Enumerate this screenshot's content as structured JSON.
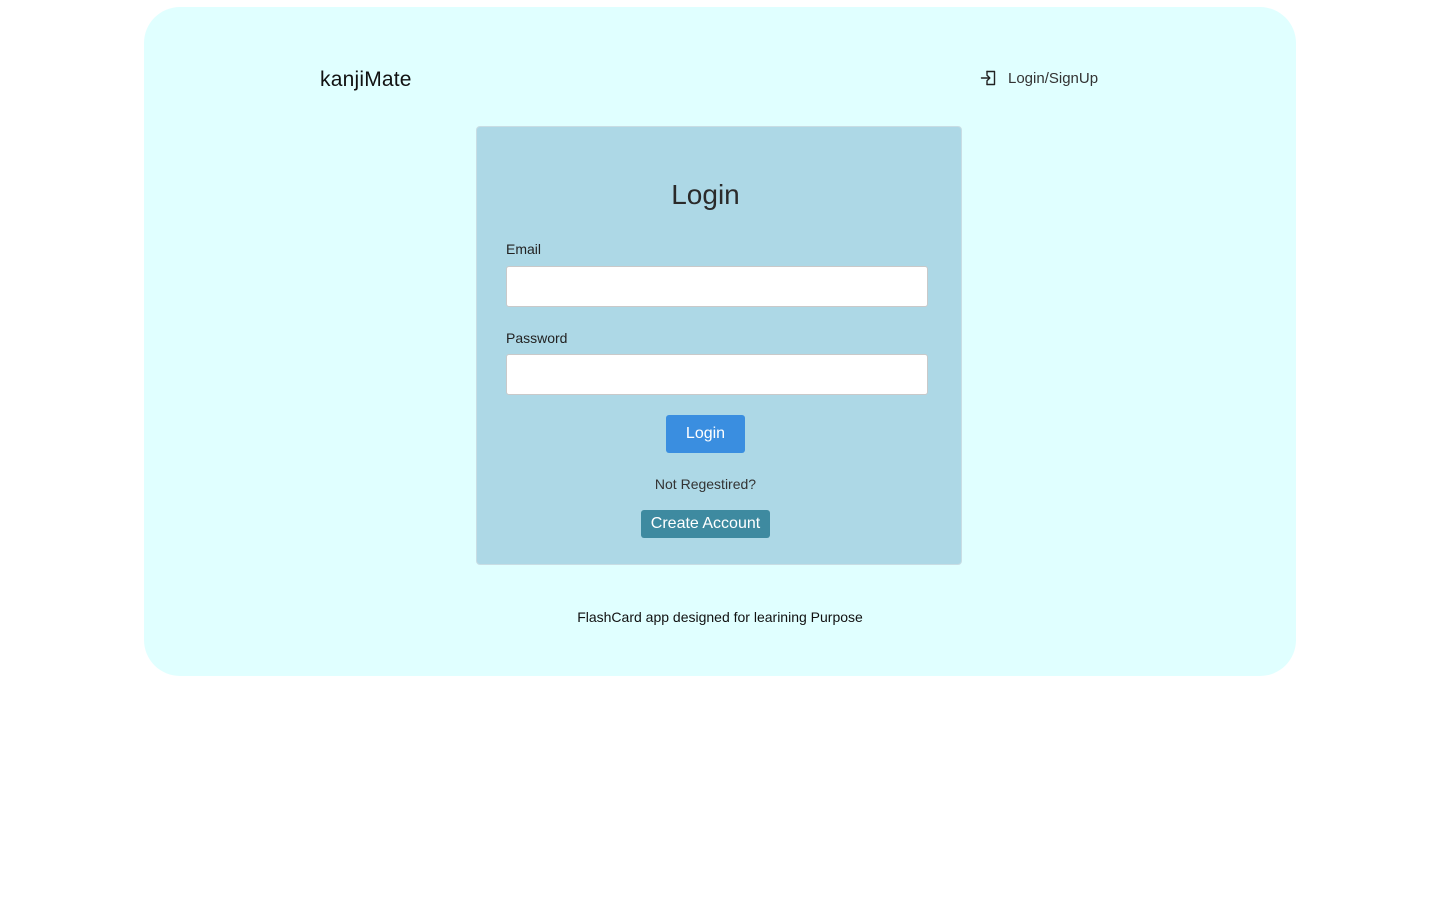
{
  "header": {
    "brand": "kanjiMate",
    "nav_login_label": "Login/SignUp",
    "nav_login_icon": "login-arrow-icon"
  },
  "login_form": {
    "title": "Login",
    "email_label": "Email",
    "email_value": "",
    "email_placeholder": "",
    "password_label": "Password",
    "password_value": "",
    "password_placeholder": "",
    "login_button": "Login",
    "not_registered_text": "Not Regestired?",
    "create_account_button": "Create Account"
  },
  "footer": {
    "text": "FlashCard app designed for learining Purpose"
  },
  "colors": {
    "page_background": "#e0ffff",
    "panel_background": "#add8e6",
    "login_button": "#3a8ee0",
    "create_account_button": "#3e8aa0"
  }
}
